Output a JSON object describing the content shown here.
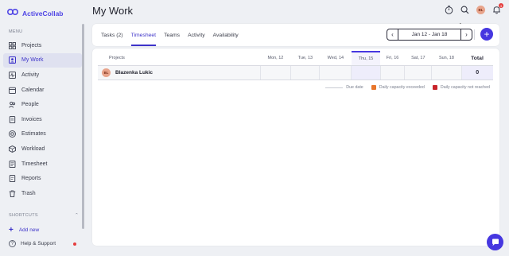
{
  "app": {
    "name": "ActiveCollab",
    "brand_color": "#5046e5"
  },
  "sidebar": {
    "menu_title": "MENU",
    "items": [
      {
        "label": "Projects",
        "icon": "projects-icon",
        "active": false
      },
      {
        "label": "My Work",
        "icon": "my-work-icon",
        "active": true
      },
      {
        "label": "Activity",
        "icon": "activity-icon",
        "active": false
      },
      {
        "label": "Calendar",
        "icon": "calendar-icon",
        "active": false
      },
      {
        "label": "People",
        "icon": "people-icon",
        "active": false
      },
      {
        "label": "Invoices",
        "icon": "invoices-icon",
        "active": false
      },
      {
        "label": "Estimates",
        "icon": "estimates-icon",
        "active": false
      },
      {
        "label": "Workload",
        "icon": "workload-icon",
        "active": false
      },
      {
        "label": "Timesheet",
        "icon": "timesheet-icon",
        "active": false
      },
      {
        "label": "Reports",
        "icon": "reports-icon",
        "active": false
      },
      {
        "label": "Trash",
        "icon": "trash-icon",
        "active": false
      }
    ],
    "shortcuts_title": "SHORTCUTS",
    "add_new": "Add new",
    "help": "Help & Support"
  },
  "header": {
    "title": "My Work",
    "avatar_initials": "BL",
    "notification_count": "3"
  },
  "tabs": [
    {
      "label": "Tasks (2)",
      "active": false
    },
    {
      "label": "Timesheet",
      "active": true
    },
    {
      "label": "Teams",
      "active": false
    },
    {
      "label": "Activity",
      "active": false
    },
    {
      "label": "Availability",
      "active": false
    }
  ],
  "date_range": {
    "label": "Jan 12 - Jan 18",
    "prev": "‹",
    "next": "›"
  },
  "timesheet": {
    "project_header": "Projects",
    "days": [
      "Mon, 12",
      "Tue, 13",
      "Wed, 14",
      "Thu, 15",
      "Fri, 16",
      "Sat, 17",
      "Sun, 18"
    ],
    "today_index": 3,
    "total_header": "Total",
    "rows": [
      {
        "initials": "BL",
        "name": "Blazenka Lukic",
        "total": "0"
      }
    ]
  },
  "legend": {
    "due_date": "Due date",
    "exceeded": "Daily capacity exceeded",
    "not_reached": "Daily capacity not reached",
    "exceeded_color": "#e8762c",
    "not_reached_color": "#c8242b"
  }
}
